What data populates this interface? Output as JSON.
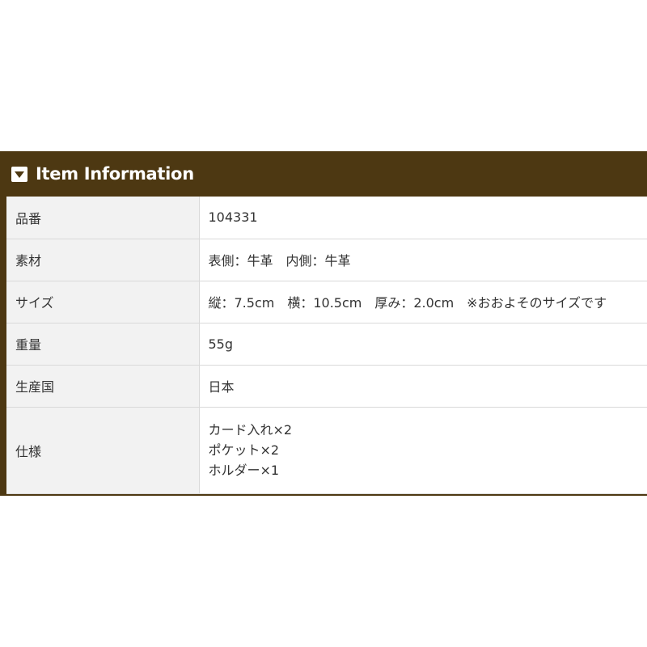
{
  "section": {
    "title": "Item Information",
    "icon": "chevron-down-icon"
  },
  "colors": {
    "header_bg": "#4d3812",
    "label_bg": "#f2f2f2",
    "border": "#d9d9d9",
    "text": "#333333"
  },
  "specs": {
    "rows": [
      {
        "label": "品番",
        "value": "104331"
      },
      {
        "label": "素材",
        "value": "表側：牛革　内側：牛革"
      },
      {
        "label": "サイズ",
        "value": "縦：7.5cm　横：10.5cm　厚み：2.0cm　※おおよそのサイズです"
      },
      {
        "label": "重量",
        "value": "55g"
      },
      {
        "label": "生産国",
        "value": "日本"
      },
      {
        "label": "仕様",
        "lines": [
          "カード入れ×2",
          "ポケット×2",
          "ホルダー×1"
        ]
      }
    ]
  }
}
